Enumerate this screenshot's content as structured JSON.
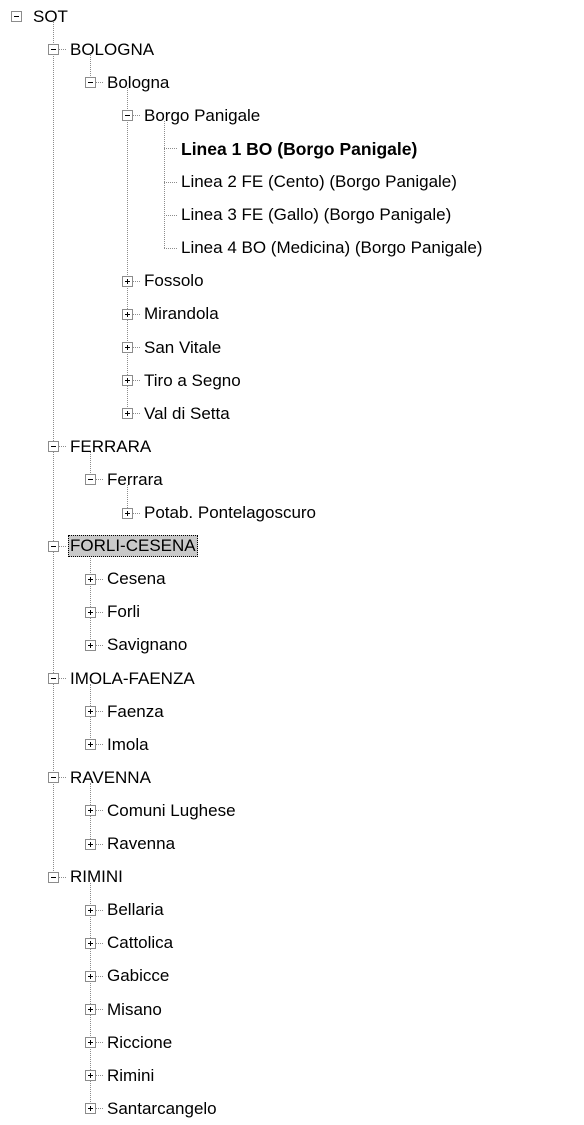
{
  "tree": [
    {
      "label": "SOT",
      "depth": 0,
      "expander": "minus"
    },
    {
      "label": "BOLOGNA",
      "depth": 1,
      "expander": "minus"
    },
    {
      "label": "Bologna",
      "depth": 2,
      "expander": "minus"
    },
    {
      "label": "Borgo Panigale",
      "depth": 3,
      "expander": "minus"
    },
    {
      "label": "Linea 1 BO (Borgo Panigale)",
      "depth": 4,
      "expander": "none",
      "bold": true
    },
    {
      "label": "Linea 2 FE (Cento) (Borgo Panigale)",
      "depth": 4,
      "expander": "none"
    },
    {
      "label": "Linea 3 FE (Gallo) (Borgo Panigale)",
      "depth": 4,
      "expander": "none"
    },
    {
      "label": "Linea 4 BO (Medicina) (Borgo Panigale)",
      "depth": 4,
      "expander": "none"
    },
    {
      "label": "Fossolo",
      "depth": 3,
      "expander": "plus"
    },
    {
      "label": "Mirandola",
      "depth": 3,
      "expander": "plus"
    },
    {
      "label": "San Vitale",
      "depth": 3,
      "expander": "plus"
    },
    {
      "label": "Tiro a Segno",
      "depth": 3,
      "expander": "plus"
    },
    {
      "label": "Val di Setta",
      "depth": 3,
      "expander": "plus"
    },
    {
      "label": "FERRARA",
      "depth": 1,
      "expander": "minus"
    },
    {
      "label": "Ferrara",
      "depth": 2,
      "expander": "minus"
    },
    {
      "label": "Potab. Pontelagoscuro",
      "depth": 3,
      "expander": "plus"
    },
    {
      "label": "FORLI-CESENA",
      "depth": 1,
      "expander": "minus",
      "selected": true
    },
    {
      "label": "Cesena",
      "depth": 2,
      "expander": "plus"
    },
    {
      "label": "Forli",
      "depth": 2,
      "expander": "plus"
    },
    {
      "label": "Savignano",
      "depth": 2,
      "expander": "plus"
    },
    {
      "label": "IMOLA-FAENZA",
      "depth": 1,
      "expander": "minus"
    },
    {
      "label": "Faenza",
      "depth": 2,
      "expander": "plus"
    },
    {
      "label": "Imola",
      "depth": 2,
      "expander": "plus"
    },
    {
      "label": "RAVENNA",
      "depth": 1,
      "expander": "minus"
    },
    {
      "label": "Comuni Lughese",
      "depth": 2,
      "expander": "plus"
    },
    {
      "label": "Ravenna",
      "depth": 2,
      "expander": "plus"
    },
    {
      "label": "RIMINI",
      "depth": 1,
      "expander": "minus"
    },
    {
      "label": "Bellaria",
      "depth": 2,
      "expander": "plus"
    },
    {
      "label": "Cattolica",
      "depth": 2,
      "expander": "plus"
    },
    {
      "label": "Gabicce",
      "depth": 2,
      "expander": "plus"
    },
    {
      "label": "Misano",
      "depth": 2,
      "expander": "plus"
    },
    {
      "label": "Riccione",
      "depth": 2,
      "expander": "plus"
    },
    {
      "label": "Rimini",
      "depth": 2,
      "expander": "plus"
    },
    {
      "label": "Santarcangelo",
      "depth": 2,
      "expander": "plus"
    }
  ],
  "colors": {
    "selection_background": "#c9c9c9",
    "connector_lines": "#8c8c8c"
  }
}
